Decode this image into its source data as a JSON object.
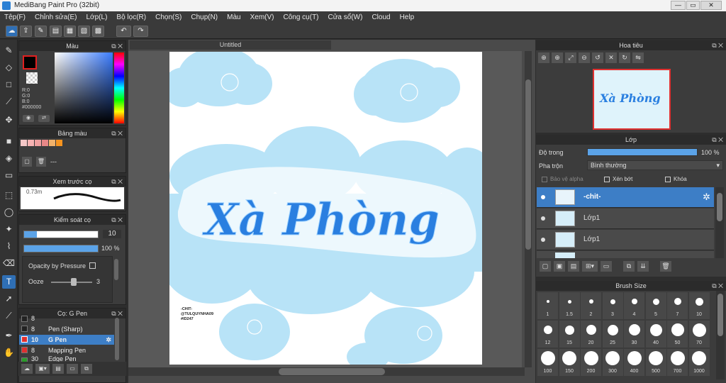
{
  "window": {
    "title": "MediBang Paint Pro (32bit)"
  },
  "menu": [
    "Tệp(F)",
    "Chỉnh sửa(E)",
    "Lớp(L)",
    "Bộ lọc(R)",
    "Chọn(S)",
    "Chụp(N)",
    "Màu",
    "Xem(V)",
    "Công cụ(T)",
    "Cửa sổ(W)",
    "Cloud",
    "Help"
  ],
  "panels": {
    "color": {
      "title": "Màu",
      "r": "R:0",
      "g": "G:0",
      "b": "B:0",
      "hex": "#000000"
    },
    "palette": {
      "title": "Bảng màu",
      "name": "---",
      "swatches": [
        "#f4c7c7",
        "#f7b3b3",
        "#f0a0a0",
        "#e98888",
        "#f2b26b",
        "#f6941f"
      ]
    },
    "brush_preview": {
      "title": "Xem trước cọ",
      "size": "0.73m"
    },
    "brush_control": {
      "title": "Kiểm soát cọ",
      "size_value": "10",
      "opacity_value": "100 %",
      "pressure_label": "Opacity by Pressure",
      "ooze_label": "Ooze",
      "ooze_value": "3"
    },
    "brush_list": {
      "title": "Cọ: G Pen",
      "items": [
        {
          "size": "8",
          "name": "",
          "color": "#222222"
        },
        {
          "size": "8",
          "name": "Pen (Sharp)",
          "color": "#222222"
        },
        {
          "size": "10",
          "name": "G Pen",
          "color": "#e03030"
        },
        {
          "size": "8",
          "name": "Mapping Pen",
          "color": "#e03030"
        },
        {
          "size": "30",
          "name": "Edge Pen",
          "color": "#2a9a2a"
        }
      ]
    }
  },
  "document": {
    "tab": "Untitled",
    "text": "Xà Phòng",
    "signature": [
      "-CHIT-",
      "@TULQUYNHA09",
      "#ID247"
    ]
  },
  "navigator": {
    "title": "Hoa tiêu"
  },
  "layers": {
    "title": "Lớp",
    "opacity_label": "Độ trong",
    "opacity_value": "100 %",
    "blend_label": "Pha trộn",
    "blend_value": "Bình thường",
    "protect_alpha": "Bảo vệ alpha",
    "clipping": "Xén bớt",
    "lock": "Khóa",
    "items": [
      {
        "name": "-chit-",
        "selected": true
      },
      {
        "name": "Lớp1",
        "selected": false
      },
      {
        "name": "Lớp1",
        "selected": false
      }
    ]
  },
  "brush_size": {
    "title": "Brush Size",
    "sizes": [
      "1",
      "1.5",
      "2",
      "3",
      "4",
      "5",
      "7",
      "10",
      "12",
      "15",
      "20",
      "25",
      "30",
      "40",
      "50",
      "70",
      "100",
      "150",
      "200",
      "300",
      "400",
      "500",
      "700",
      "1000"
    ]
  },
  "colors": {
    "accent": "#3d7ec6",
    "cloud": "#b8e3f7",
    "text": "#2a7fe0"
  }
}
